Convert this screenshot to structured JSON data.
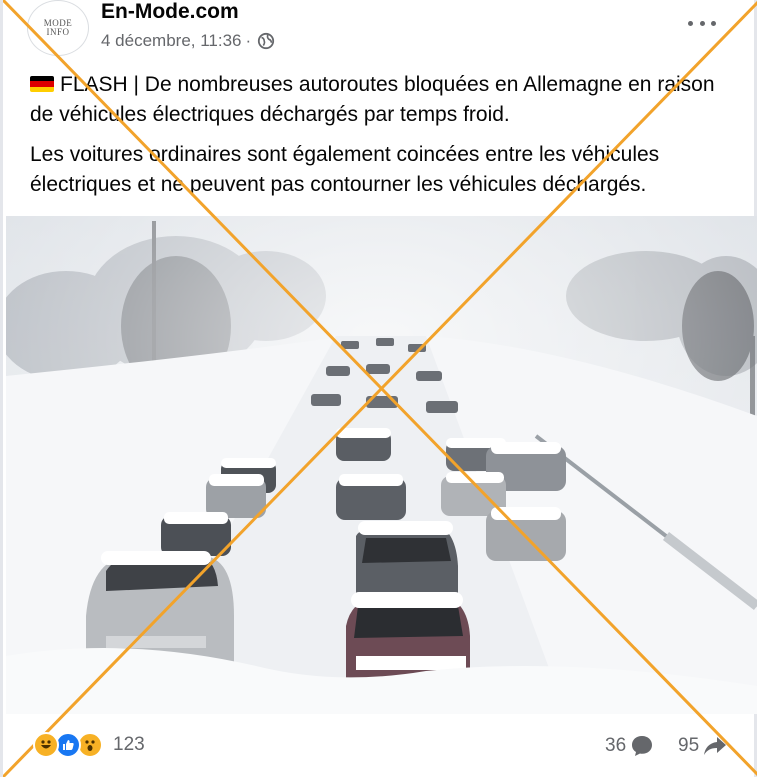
{
  "post": {
    "page_name": "En-Mode.com",
    "avatar_text": "MODE INFO",
    "date": "4 décembre, 11:36",
    "separator": "·",
    "paragraph_1": "FLASH | De nombreuses autoroutes bloquées en Allemagne en raison de véhicules électriques déchargés par temps froid.",
    "paragraph_2": "Les voitures ordinaires sont également coincées entre les véhicules électriques et ne peuvent pas contourner les véhicules déchargés."
  },
  "footer": {
    "reaction_count": "123",
    "comment_count": "36",
    "share_count": "95"
  },
  "icons": {
    "flag": "germany-flag-icon",
    "audience": "globe-icon",
    "menu": "more-options-icon",
    "comment": "comment-icon",
    "share": "share-icon",
    "reactions": [
      "haha-icon",
      "like-icon",
      "wow-icon"
    ]
  },
  "colors": {
    "overlay_cross": "#f2a32b",
    "meta_text": "#65676b",
    "like_blue": "#1877f2",
    "emoji_yellow": "#f7b125"
  }
}
